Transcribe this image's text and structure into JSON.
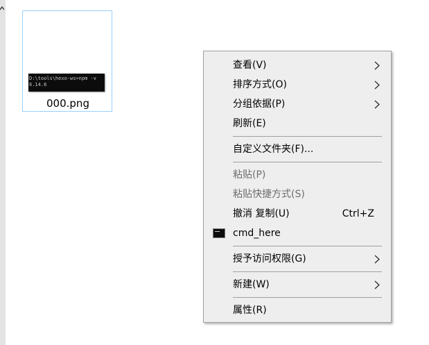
{
  "desktop": {
    "file": {
      "name": "000.png",
      "thumbnail_text": "D:\\tools\\hexo-ws>npm -v\n6.14.6"
    }
  },
  "context_menu": {
    "items": [
      {
        "label": "查看(V)",
        "submenu": true
      },
      {
        "label": "排序方式(O)",
        "submenu": true
      },
      {
        "label": "分组依据(P)",
        "submenu": true
      },
      {
        "label": "刷新(E)"
      },
      {
        "label": "自定义文件夹(F)..."
      },
      {
        "label": "粘贴(P)",
        "disabled": true
      },
      {
        "label": "粘贴快捷方式(S)",
        "disabled": true
      },
      {
        "label": "撤消 复制(U)",
        "shortcut": "Ctrl+Z"
      },
      {
        "label": "cmd_here",
        "icon": "cmd-icon"
      },
      {
        "label": "授予访问权限(G)",
        "submenu": true
      },
      {
        "label": "新建(W)",
        "submenu": true
      },
      {
        "label": "属性(R)"
      }
    ]
  }
}
